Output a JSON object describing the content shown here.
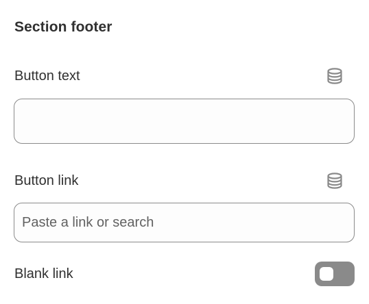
{
  "section": {
    "title": "Section footer"
  },
  "fields": {
    "button_text": {
      "label": "Button text",
      "value": "",
      "placeholder": "",
      "icon": "database-icon"
    },
    "button_link": {
      "label": "Button link",
      "value": "",
      "placeholder": "Paste a link or search",
      "icon": "database-icon"
    },
    "blank_link": {
      "label": "Blank link",
      "toggle_on": false
    }
  },
  "colors": {
    "text": "#303030",
    "border": "#8a8a8a",
    "toggle_off": "#8a8a8a",
    "placeholder": "#616161"
  }
}
